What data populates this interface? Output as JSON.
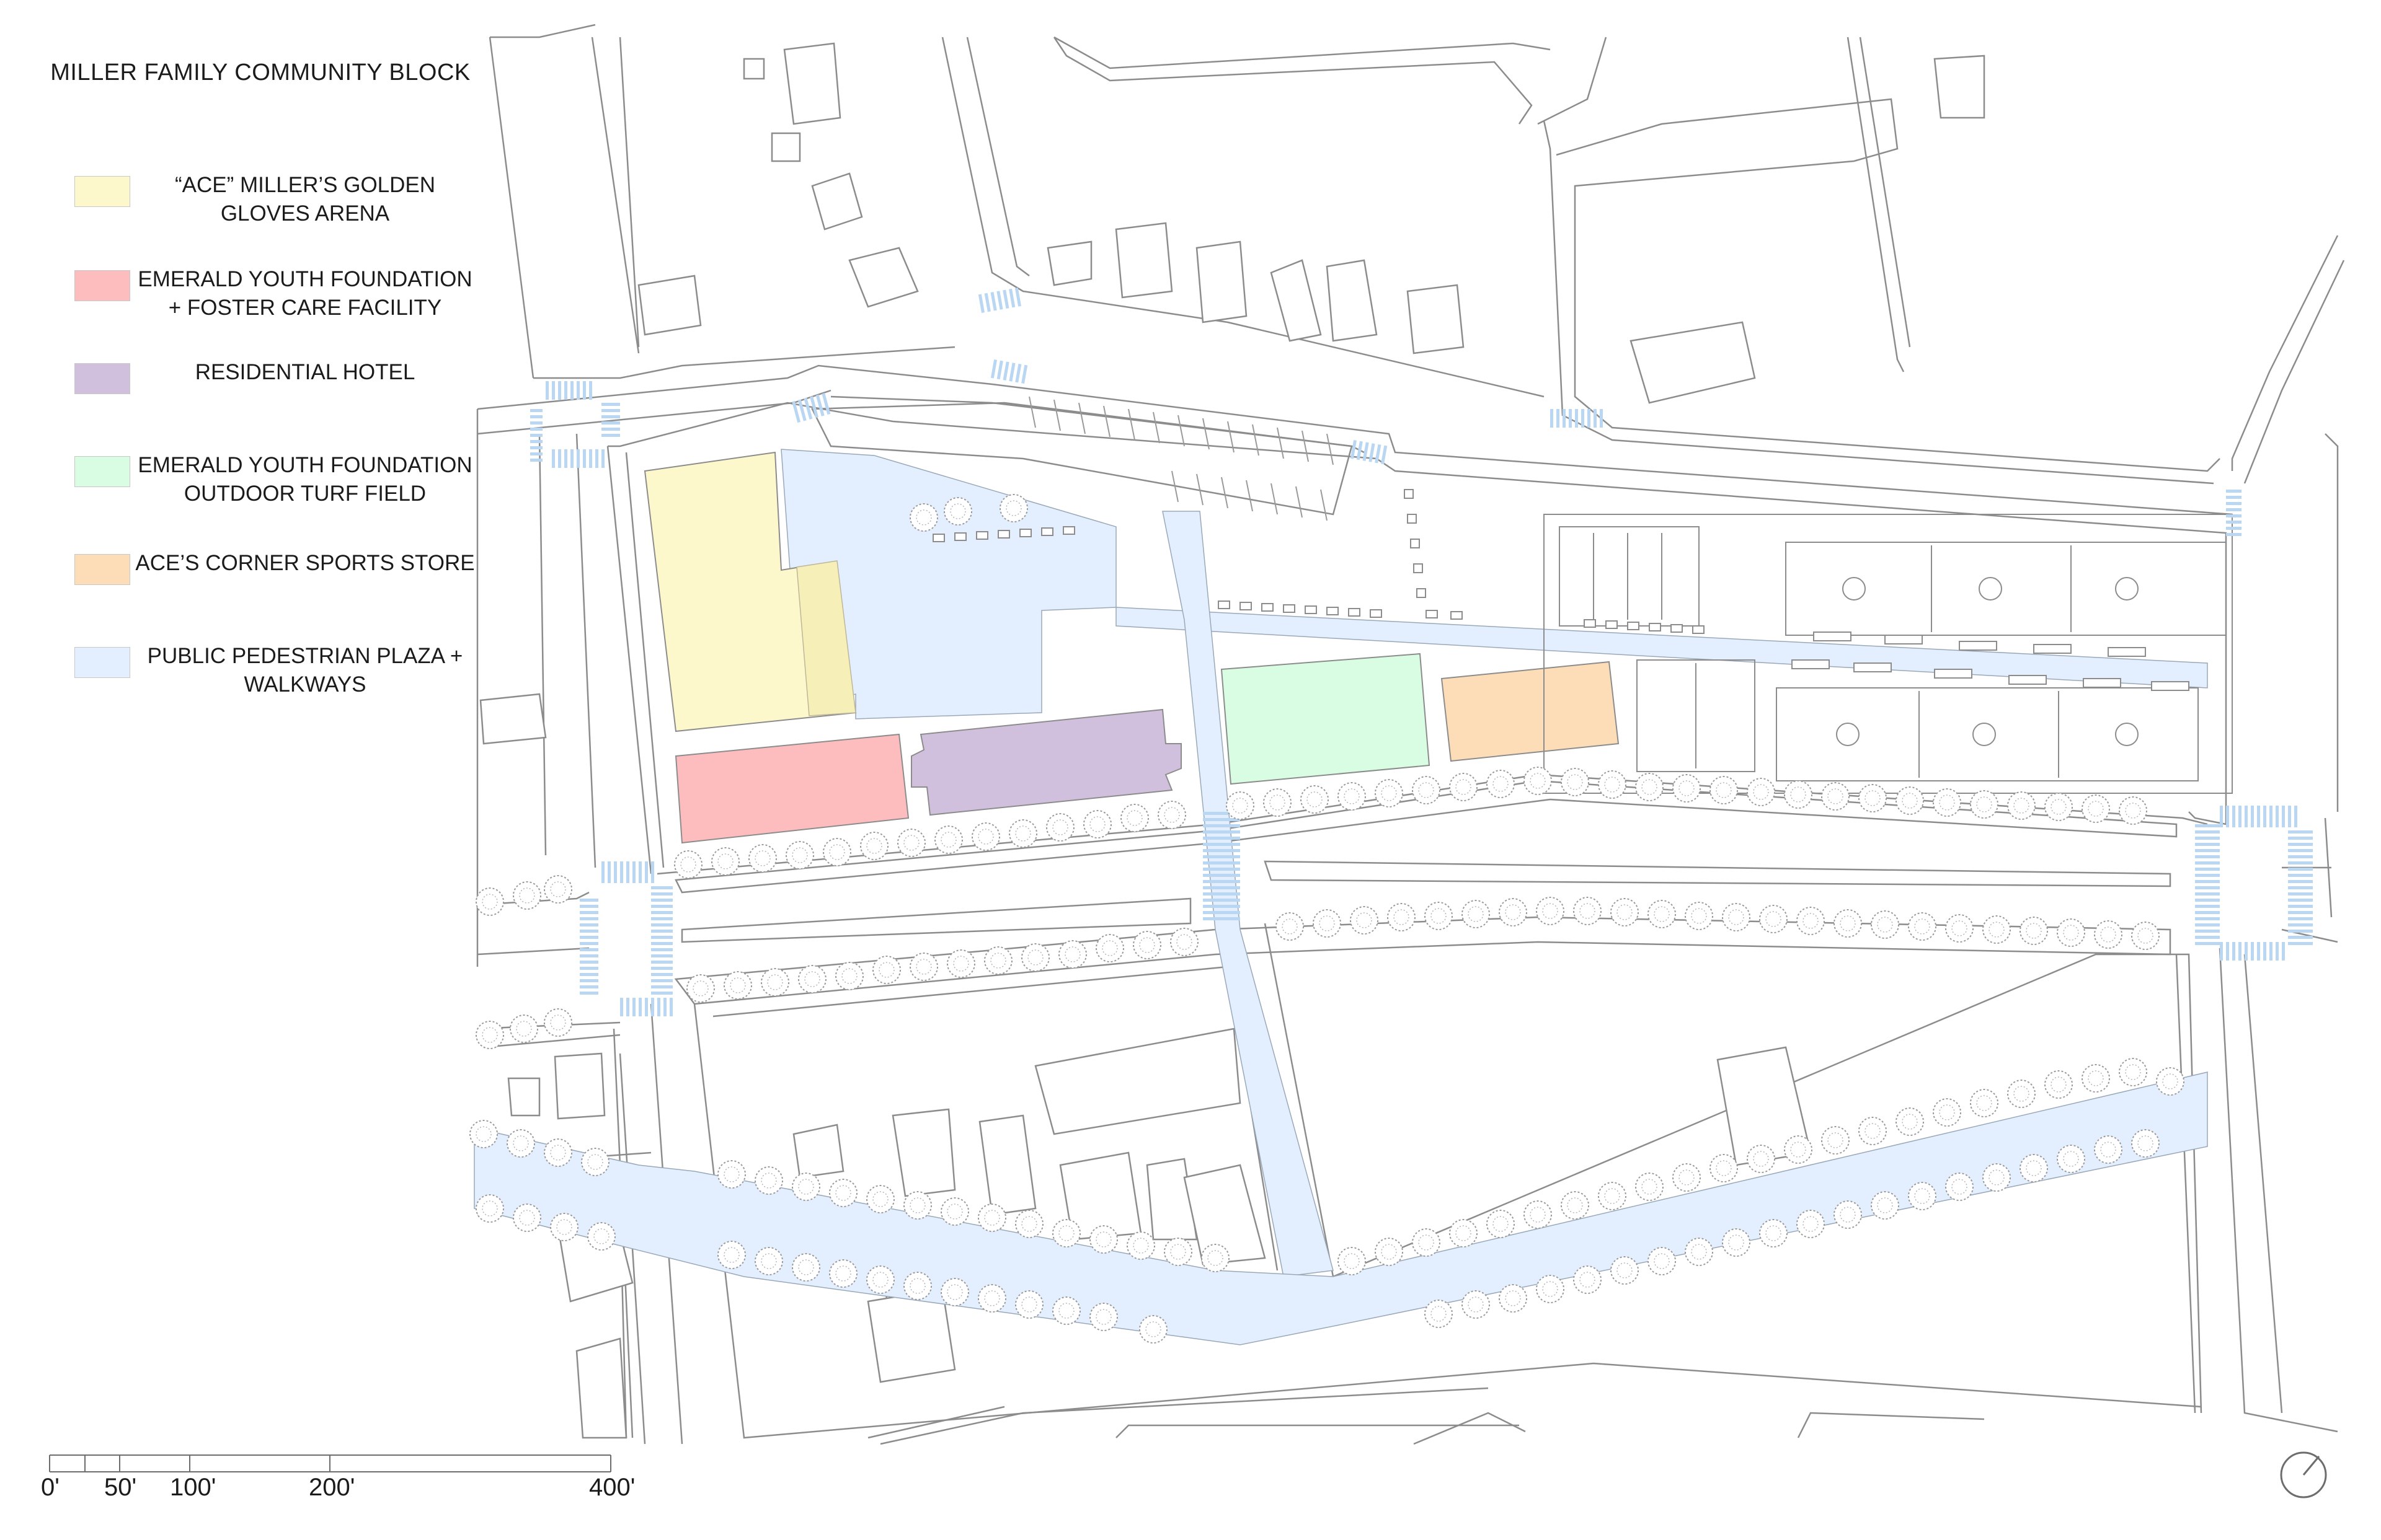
{
  "legend": {
    "title": "MILLER FAMILY COMMUNITY BLOCK",
    "items": [
      {
        "label": "“ACE” MILLER’S GOLDEN GLOVES ARENA",
        "color": "#fdf8cc"
      },
      {
        "label": "EMERALD YOUTH FOUNDATION + FOSTER CARE FACILITY",
        "color": "#fdbdbf"
      },
      {
        "label": "RESIDENTIAL HOTEL",
        "color": "#d1c0dd"
      },
      {
        "label": "EMERALD YOUTH FOUNDATION OUTDOOR TURF FIELD",
        "color": "#d8fde2"
      },
      {
        "label": "ACE’S CORNER SPORTS STORE",
        "color": "#fdddb7"
      },
      {
        "label": "PUBLIC PEDESTRIAN PLAZA + WALKWAYS",
        "color": "#e3efff"
      }
    ]
  },
  "scale_bar": {
    "labels": [
      "0'",
      "50'",
      "100'",
      "200'",
      "400'"
    ]
  },
  "north_arrow": {
    "icon": "north-arrow-icon"
  },
  "colors": {
    "line": "#8a8a8a",
    "crosswalk": "#b9d6f2"
  }
}
